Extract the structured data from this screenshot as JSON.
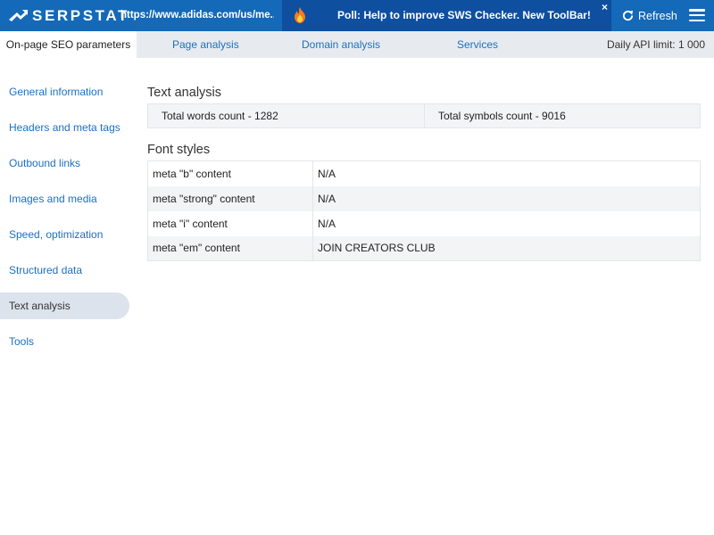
{
  "topbar": {
    "brand": "SERPSTAT",
    "url": "https://www.adidas.com/us/me...",
    "poll_text": "Poll: Help to improve SWS Checker. New ToolBar!",
    "poll_close": "×",
    "refresh_label": "Refresh",
    "brand_color": "#1469b8",
    "icons": [
      "serpstat-logo-icon",
      "fire-icon",
      "close-icon",
      "refresh-icon",
      "hamburger-menu-icon"
    ]
  },
  "tabs": {
    "active": "On-page SEO parameters",
    "items": [
      "Page analysis",
      "Domain analysis",
      "Services"
    ],
    "api_limit": "Daily API limit: 1 000"
  },
  "sidebar": {
    "items": [
      "General information",
      "Headers and meta tags",
      "Outbound links",
      "Images and media",
      "Speed, optimization",
      "Structured data",
      "Text analysis",
      "Tools"
    ],
    "active_index": 6
  },
  "main": {
    "text_analysis": {
      "title": "Text analysis",
      "words": "Total words count - 1282",
      "symbols": "Total symbols count - 9016"
    },
    "font_styles": {
      "title": "Font styles",
      "rows": [
        {
          "key": "meta \"b\" content",
          "value": "N/A"
        },
        {
          "key": "meta \"strong\" content",
          "value": "N/A"
        },
        {
          "key": "meta \"i\" content",
          "value": "N/A"
        },
        {
          "key": "meta \"em\" content",
          "value": "JOIN CREATORS CLUB"
        }
      ]
    }
  }
}
